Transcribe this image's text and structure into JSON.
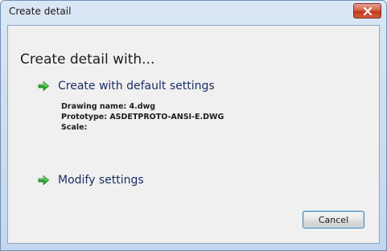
{
  "window": {
    "title": "Create detail"
  },
  "dialog": {
    "heading": "Create detail with...",
    "option_default": {
      "label": "Create with default settings",
      "icon": "green-arrow-icon"
    },
    "details": {
      "drawing_name": "Drawing name: 4.dwg",
      "prototype": "Prototype: ASDETPROTO-ANSI-E.DWG",
      "scale": "Scale:"
    },
    "option_modify": {
      "label": "Modify settings",
      "icon": "green-arrow-icon"
    },
    "cancel_label": "Cancel"
  },
  "colors": {
    "link_text": "#1b2f66",
    "arrow_green": "#2aa52a",
    "close_red": "#c2391e"
  }
}
